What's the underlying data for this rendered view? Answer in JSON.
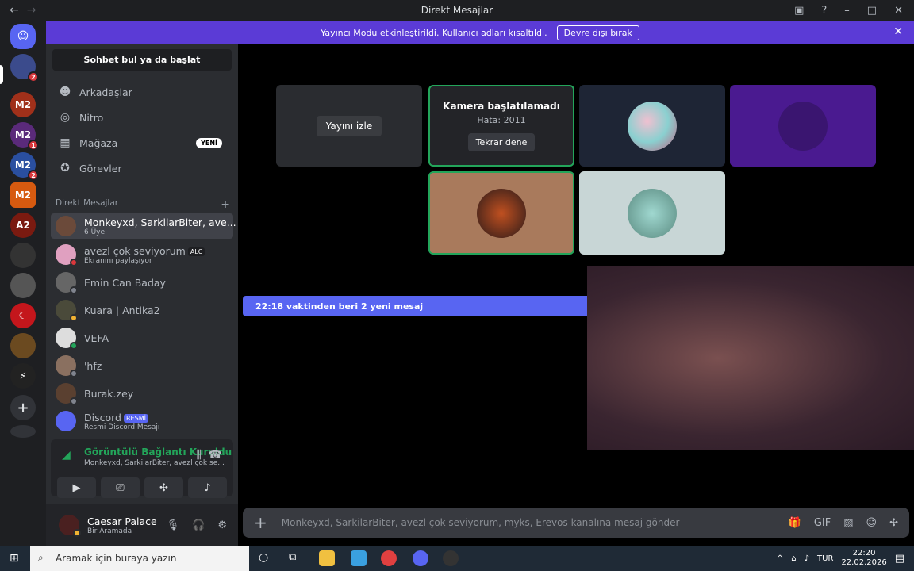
{
  "window": {
    "title": "Direkt Mesajlar"
  },
  "banner": {
    "text": "Yayıncı Modu etkinleştirildi. Kullanıcı adları kısaltıldı.",
    "button": "Devre dışı bırak"
  },
  "sidebar": {
    "search": "Sohbet bul ya da başlat",
    "nav": [
      {
        "label": "Arkadaşlar",
        "icon": "friends-icon"
      },
      {
        "label": "Nitro",
        "icon": "nitro-icon"
      },
      {
        "label": "Mağaza",
        "icon": "store-icon",
        "badge": "YENİ"
      },
      {
        "label": "Görevler",
        "icon": "quests-icon"
      }
    ],
    "dm_header": "Direkt Mesajlar",
    "dms": [
      {
        "name": "Monkeyxd, SarkilarBiter, ave...",
        "sub": "6 Üye",
        "active": true
      },
      {
        "name": "avezl çok seviyorum",
        "tag": "ALC",
        "sub": "Ekranını paylaşıyor"
      },
      {
        "name": "Emin Can Baday"
      },
      {
        "name": "Kuara | Antika2"
      },
      {
        "name": "VEFA"
      },
      {
        "name": "'hfz"
      },
      {
        "name": "Burak.zey"
      },
      {
        "name": "Discord",
        "tag": "RESMİ",
        "sub": "Resmi Discord Mesajı"
      }
    ],
    "voice": {
      "status": "Görüntülü Bağlantı Kuruldu",
      "channel": "Monkeyxd, SarkilarBiter, avezl çok se..."
    },
    "user": {
      "name": "Caesar Palace",
      "status": "Bir Aramada"
    }
  },
  "call": {
    "stream_button": "Yayını izle",
    "camera_error_title": "Kamera başlatılamadı",
    "camera_error_code": "Hata: 2011",
    "retry_button": "Tekrar dene"
  },
  "new_messages": "22:18 vaktinden beri 2 yeni mesaj",
  "composer": {
    "placeholder": "Monkeyxd, SarkilarBiter, avezl çok seviyorum, myks, Erevos kanalına mesaj gönder"
  },
  "servers": [
    {
      "label": "",
      "badge": ""
    },
    {
      "label": "",
      "badge": "2"
    },
    {
      "label": "M2",
      "badge": ""
    },
    {
      "label": "M2",
      "badge": "1"
    },
    {
      "label": "M2",
      "badge": "2"
    },
    {
      "label": "M2",
      "badge": ""
    },
    {
      "label": "A2",
      "badge": ""
    }
  ],
  "taskbar": {
    "search": "Aramak için buraya yazın",
    "lang": "TUR",
    "time": "22:20",
    "date": "22.02.2026"
  },
  "colors": {
    "accent": "#5865f2",
    "banner": "#5b3bd6",
    "online": "#23a55a"
  }
}
